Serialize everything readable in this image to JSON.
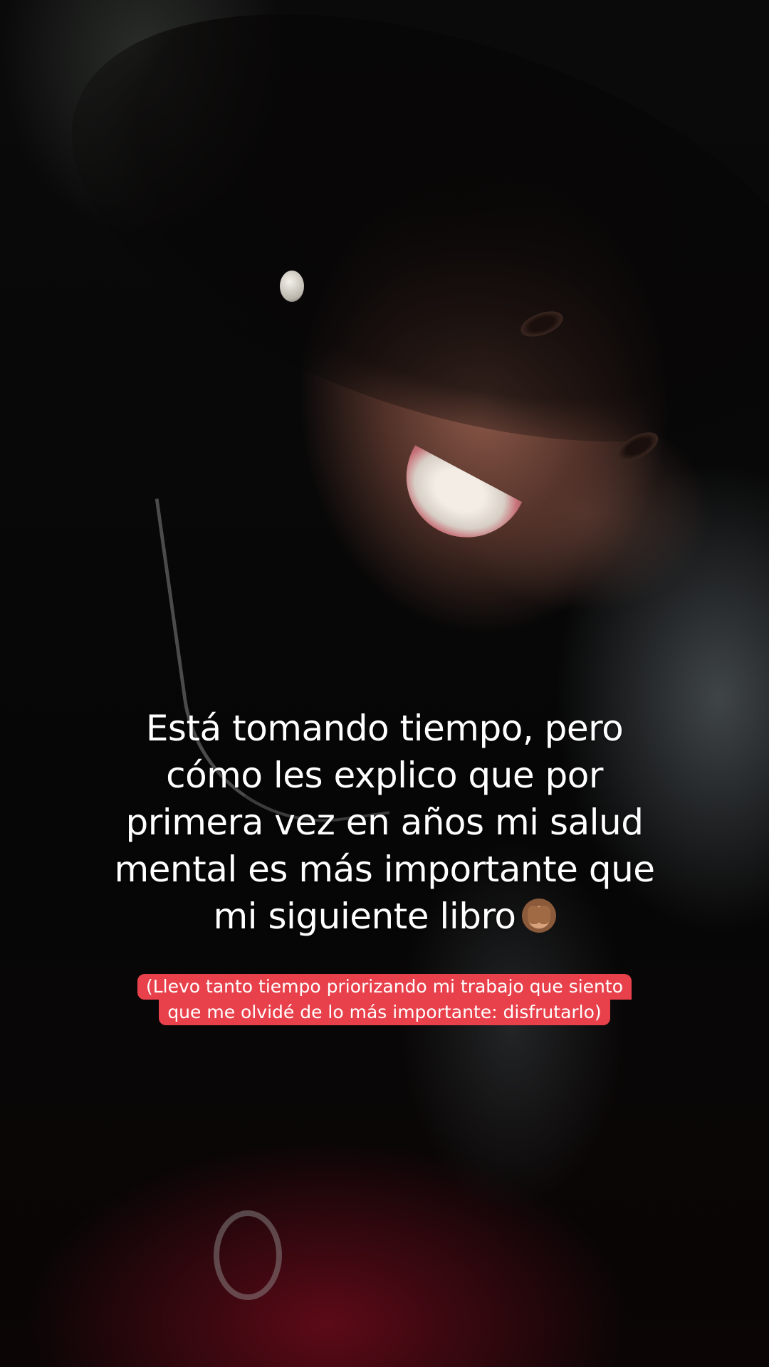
{
  "caption": {
    "lines": [
      "Está tomando tiempo, pero",
      "cómo les explico que por",
      "primera vez en años mi salud",
      "mental es más importante que",
      "mi siguiente libro"
    ],
    "emoji": "see-no-evil-monkey"
  },
  "subtitle": {
    "lines": [
      "(Llevo tanto tiempo priorizando mi trabajo que siento",
      "que me olvidé de lo más importante: disfrutarlo)"
    ]
  },
  "colors": {
    "subtitle_background": "#e8414b",
    "text": "#ffffff"
  }
}
